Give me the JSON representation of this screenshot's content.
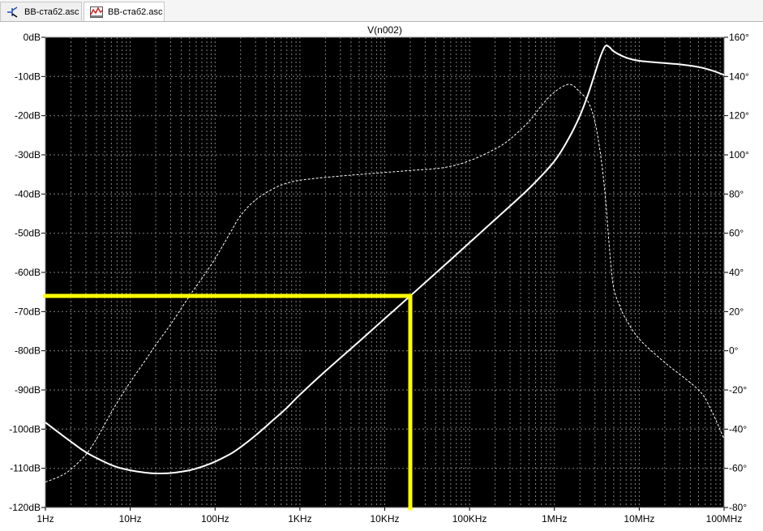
{
  "tabs": [
    {
      "label": "ВВ-стаб2.asc",
      "icon": "schematic-icon",
      "active": false
    },
    {
      "label": "ВВ-стаб2.asc",
      "icon": "waveform-icon",
      "active": true
    }
  ],
  "colors": {
    "plot_bg": "#000000",
    "trace": "#ffffff",
    "grid": "#808080",
    "highlight": "#ffff00",
    "axis_text": "#000000"
  },
  "chart_data": {
    "type": "line",
    "title": "V(n002)",
    "x_scale": "log",
    "xlim": [
      1,
      100000000
    ],
    "grid": true,
    "minor_x_grid": true,
    "x_ticks": [
      {
        "value": 1,
        "label": "1Hz"
      },
      {
        "value": 10,
        "label": "10Hz"
      },
      {
        "value": 100,
        "label": "100Hz"
      },
      {
        "value": 1000,
        "label": "1KHz"
      },
      {
        "value": 10000,
        "label": "10KHz"
      },
      {
        "value": 100000,
        "label": "100KHz"
      },
      {
        "value": 1000000,
        "label": "1MHz"
      },
      {
        "value": 10000000,
        "label": "10MHz"
      },
      {
        "value": 100000000,
        "label": "100MHz"
      }
    ],
    "y_left": {
      "lim": [
        -120,
        0
      ],
      "ticks": [
        {
          "value": 0,
          "label": "0dB"
        },
        {
          "value": -10,
          "label": "-10dB"
        },
        {
          "value": -20,
          "label": "-20dB"
        },
        {
          "value": -30,
          "label": "-30dB"
        },
        {
          "value": -40,
          "label": "-40dB"
        },
        {
          "value": -50,
          "label": "-50dB"
        },
        {
          "value": -60,
          "label": "-60dB"
        },
        {
          "value": -70,
          "label": "-70dB"
        },
        {
          "value": -80,
          "label": "-80dB"
        },
        {
          "value": -90,
          "label": "-90dB"
        },
        {
          "value": -100,
          "label": "-100dB"
        },
        {
          "value": -110,
          "label": "-110dB"
        },
        {
          "value": -120,
          "label": "-120dB"
        }
      ]
    },
    "y_right": {
      "lim": [
        -80,
        160
      ],
      "ticks": [
        {
          "value": 160,
          "label": "160°"
        },
        {
          "value": 140,
          "label": "140°"
        },
        {
          "value": 120,
          "label": "120°"
        },
        {
          "value": 100,
          "label": "100°"
        },
        {
          "value": 80,
          "label": "80°"
        },
        {
          "value": 60,
          "label": "60°"
        },
        {
          "value": 40,
          "label": "40°"
        },
        {
          "value": 20,
          "label": "20°"
        },
        {
          "value": 0,
          "label": "0°"
        },
        {
          "value": -20,
          "label": "-20°"
        },
        {
          "value": -40,
          "label": "-40°"
        },
        {
          "value": -60,
          "label": "-60°"
        },
        {
          "value": -80,
          "label": "-80°"
        }
      ]
    },
    "series": [
      {
        "axis": "left",
        "line_style": "solid",
        "points": [
          [
            1,
            -98.3
          ],
          [
            1.5,
            -101.2
          ],
          [
            2,
            -103.2
          ],
          [
            3,
            -105.9
          ],
          [
            5,
            -108.4
          ],
          [
            7,
            -109.7
          ],
          [
            10,
            -110.5
          ],
          [
            15,
            -111.1
          ],
          [
            20,
            -111.3
          ],
          [
            30,
            -111.2
          ],
          [
            50,
            -110.5
          ],
          [
            70,
            -109.6
          ],
          [
            100,
            -108.3
          ],
          [
            150,
            -106.4
          ],
          [
            200,
            -104.6
          ],
          [
            300,
            -101.6
          ],
          [
            500,
            -97.4
          ],
          [
            700,
            -94.6
          ],
          [
            1000,
            -91.2
          ],
          [
            2000,
            -85.2
          ],
          [
            5000,
            -77.6
          ],
          [
            10000,
            -71.8
          ],
          [
            20000,
            -66
          ],
          [
            50000,
            -58.3
          ],
          [
            100000,
            -52.4
          ],
          [
            200000,
            -46.5
          ],
          [
            500000,
            -38.6
          ],
          [
            1000000,
            -31.6
          ],
          [
            1500000,
            -25.5
          ],
          [
            2000000,
            -20
          ],
          [
            2500000,
            -14.5
          ],
          [
            3000000,
            -9.2
          ],
          [
            3500000,
            -4.8
          ],
          [
            4000000,
            -2.2
          ],
          [
            4500000,
            -2.6
          ],
          [
            5000000,
            -3.6
          ],
          [
            7000000,
            -5.2
          ],
          [
            10000000,
            -6
          ],
          [
            20000000,
            -6.6
          ],
          [
            30000000,
            -6.9
          ],
          [
            50000000,
            -7.6
          ],
          [
            70000000,
            -8.4
          ],
          [
            100000000,
            -9.6
          ]
        ]
      },
      {
        "axis": "right",
        "line_style": "dashed",
        "points": [
          [
            1,
            -67
          ],
          [
            1.5,
            -64
          ],
          [
            2,
            -60.5
          ],
          [
            3,
            -53
          ],
          [
            4,
            -45
          ],
          [
            5,
            -37.5
          ],
          [
            7,
            -26.5
          ],
          [
            10,
            -16
          ],
          [
            15,
            -5
          ],
          [
            20,
            3
          ],
          [
            30,
            13.5
          ],
          [
            50,
            28
          ],
          [
            70,
            37
          ],
          [
            100,
            47
          ],
          [
            150,
            60
          ],
          [
            200,
            69
          ],
          [
            300,
            77
          ],
          [
            500,
            83
          ],
          [
            700,
            85.5
          ],
          [
            1000,
            87
          ],
          [
            2000,
            88.5
          ],
          [
            5000,
            90
          ],
          [
            10000,
            91
          ],
          [
            20000,
            92
          ],
          [
            50000,
            93.5
          ],
          [
            100000,
            97
          ],
          [
            200000,
            103
          ],
          [
            300000,
            108
          ],
          [
            500000,
            117
          ],
          [
            700000,
            125
          ],
          [
            1000000,
            132
          ],
          [
            1500000,
            136
          ],
          [
            2000000,
            132
          ],
          [
            2500000,
            127
          ],
          [
            3000000,
            117
          ],
          [
            3500000,
            100
          ],
          [
            4000000,
            78
          ],
          [
            4500000,
            50
          ],
          [
            5000000,
            32
          ],
          [
            6000000,
            22
          ],
          [
            7000000,
            16
          ],
          [
            10000000,
            6
          ],
          [
            20000000,
            -6
          ],
          [
            50000000,
            -20
          ],
          [
            70000000,
            -30
          ],
          [
            100000000,
            -45
          ]
        ]
      }
    ],
    "highlight": {
      "x": 20000,
      "y": -66,
      "axis": "left"
    }
  }
}
